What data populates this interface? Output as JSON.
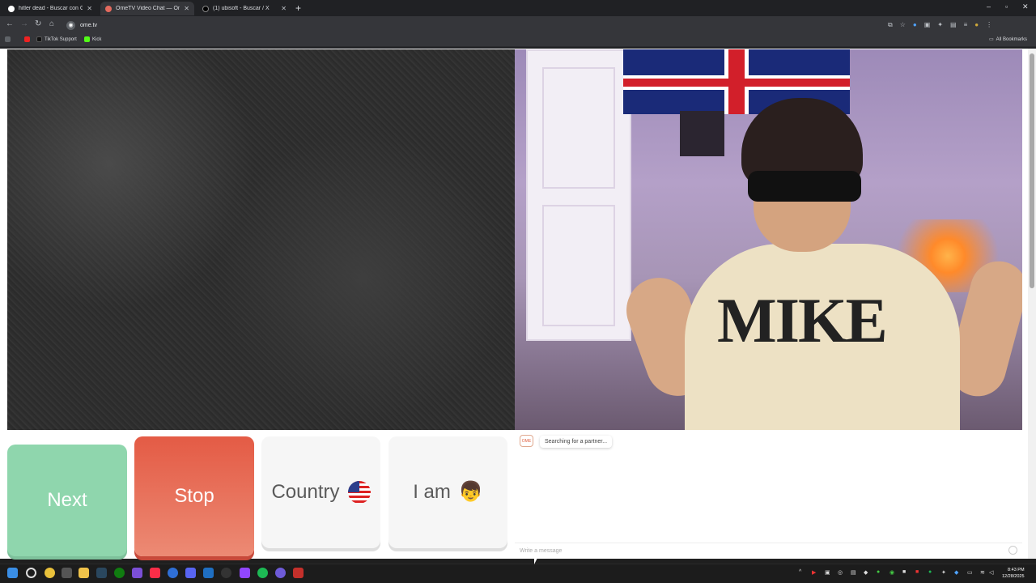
{
  "browser": {
    "tabs": [
      {
        "title": "hitler dead - Buscar con Google",
        "active": false
      },
      {
        "title": "OmeTV Video Chat — Ome",
        "active": true
      },
      {
        "title": "(1) ubisoft - Buscar / X",
        "active": false
      }
    ],
    "url": "ome.tv",
    "bookmarks": [
      "TikTok Support",
      "Kick"
    ],
    "all_bookmarks": "All Bookmarks"
  },
  "controls": {
    "next": "Next",
    "stop": "Stop",
    "country": "Country",
    "iam": "I am",
    "iam_emoji": "👦"
  },
  "chat": {
    "status": "Searching for a partner...",
    "input_placeholder": "Write a message"
  },
  "camera": {
    "shirt_text": "MIKE"
  },
  "taskbar": {
    "time": "8:43 PM",
    "date": "12/28/2025"
  },
  "colors": {
    "next": "#8fd6ad",
    "stop": "#e45b45",
    "neutral": "#f6f6f6"
  }
}
